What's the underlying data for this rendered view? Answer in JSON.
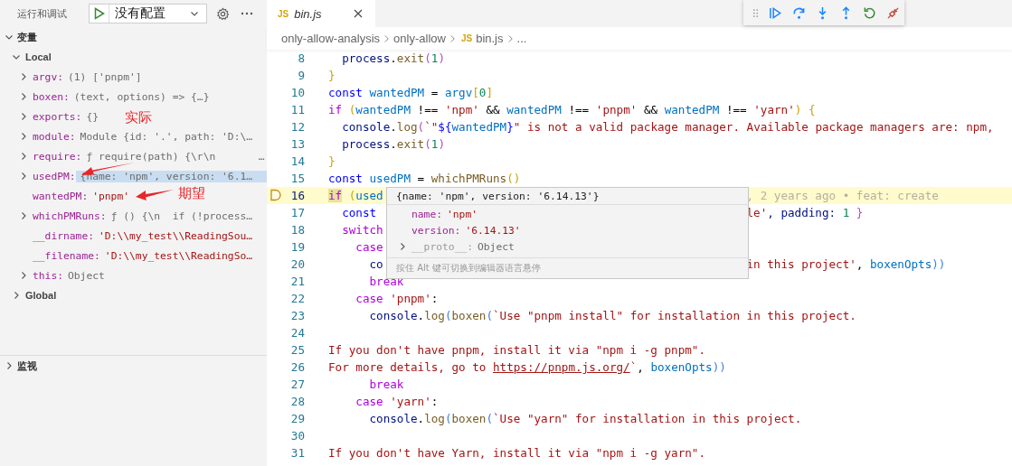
{
  "sidebar": {
    "title": "运行和调试",
    "config": {
      "label": "没有配置"
    },
    "sections": [
      {
        "title": "变量",
        "expanded": true,
        "scopes": [
          {
            "name": "Local",
            "expanded": true,
            "variables": [
              {
                "name": "argv:",
                "value": "(1) ['pnpm']",
                "kind": "object",
                "expandable": true,
                "selected": false
              },
              {
                "name": "boxen:",
                "value": "(text, options) => {…}",
                "kind": "object",
                "expandable": true,
                "selected": false
              },
              {
                "name": "exports:",
                "value": "{}",
                "kind": "object",
                "expandable": true,
                "selected": false
              },
              {
                "name": "module:",
                "value": "Module {id: '.', path: 'D:\\…",
                "kind": "object",
                "expandable": true,
                "selected": false
              },
              {
                "name": "require:",
                "value": "ƒ require(path) {\\r\\n       …",
                "kind": "object",
                "expandable": true,
                "selected": false
              },
              {
                "name": "usedPM:",
                "value": "{name: 'npm', version: '6.1…",
                "kind": "object",
                "expandable": true,
                "selected": true
              },
              {
                "name": "wantedPM:",
                "value": "'pnpm'",
                "kind": "string",
                "expandable": false,
                "selected": false
              },
              {
                "name": "whichPMRuns:",
                "value": "ƒ () {\\n  if (!process…",
                "kind": "object",
                "expandable": true,
                "selected": false
              },
              {
                "name": "__dirname:",
                "value": "'D:\\\\my_test\\\\ReadingSou…",
                "kind": "string",
                "expandable": false,
                "selected": false
              },
              {
                "name": "__filename:",
                "value": "'D:\\\\my_test\\\\ReadingSo…",
                "kind": "string",
                "expandable": false,
                "selected": false
              },
              {
                "name": "this:",
                "value": "Object",
                "kind": "object",
                "expandable": true,
                "selected": false
              }
            ]
          },
          {
            "name": "Global",
            "expanded": false
          }
        ]
      },
      {
        "title": "监视",
        "expanded": false
      }
    ]
  },
  "annotations": [
    {
      "text": "实际"
    },
    {
      "text": "期望"
    }
  ],
  "tab": {
    "icon": "JS",
    "label": "bin.js"
  },
  "breadcrumbs": [
    {
      "text": "only-allow-analysis"
    },
    {
      "text": "only-allow"
    },
    {
      "text": "bin.js",
      "icon": "JS"
    },
    {
      "text": "..."
    }
  ],
  "code": [
    {
      "number": "8",
      "current": false,
      "tokens": [
        {
          "text": "  process",
          "kind": "var"
        },
        {
          "text": ".",
          "kind": "plain"
        },
        {
          "text": "exit",
          "kind": "fn"
        },
        {
          "text": "(",
          "kind": "b2"
        },
        {
          "text": "1",
          "kind": "num"
        },
        {
          "text": ")",
          "kind": "b2"
        }
      ]
    },
    {
      "number": "9",
      "current": false,
      "tokens": [
        {
          "text": "}",
          "kind": "b1"
        }
      ]
    },
    {
      "number": "10",
      "current": false,
      "tokens": [
        {
          "text": "const",
          "kind": "decl"
        },
        {
          "text": " wantedPM",
          "kind": "cvar"
        },
        {
          "text": " = ",
          "kind": "plain"
        },
        {
          "text": "argv",
          "kind": "cvar"
        },
        {
          "text": "[",
          "kind": "b1"
        },
        {
          "text": "0",
          "kind": "num"
        },
        {
          "text": "]",
          "kind": "b1"
        }
      ]
    },
    {
      "number": "11",
      "current": false,
      "tokens": [
        {
          "text": "if",
          "kind": "kw"
        },
        {
          "text": " (",
          "kind": "b1"
        },
        {
          "text": "wantedPM",
          "kind": "cvar"
        },
        {
          "text": " !== ",
          "kind": "plain"
        },
        {
          "text": "'npm'",
          "kind": "str"
        },
        {
          "text": " && ",
          "kind": "plain"
        },
        {
          "text": "wantedPM",
          "kind": "cvar"
        },
        {
          "text": " !== ",
          "kind": "plain"
        },
        {
          "text": "'pnpm'",
          "kind": "str"
        },
        {
          "text": " && ",
          "kind": "plain"
        },
        {
          "text": "wantedPM",
          "kind": "cvar"
        },
        {
          "text": " !== ",
          "kind": "plain"
        },
        {
          "text": "'yarn'",
          "kind": "str"
        },
        {
          "text": ") {",
          "kind": "b1"
        }
      ]
    },
    {
      "number": "12",
      "current": false,
      "tokens": [
        {
          "text": "  console",
          "kind": "var"
        },
        {
          "text": ".",
          "kind": "plain"
        },
        {
          "text": "log",
          "kind": "fn"
        },
        {
          "text": "(",
          "kind": "b2"
        },
        {
          "text": "`\"",
          "kind": "str"
        },
        {
          "text": "${",
          "kind": "decl"
        },
        {
          "text": "wantedPM",
          "kind": "cvar"
        },
        {
          "text": "}",
          "kind": "decl"
        },
        {
          "text": "\" is not a valid package manager. Available package managers are: npm, ",
          "kind": "str"
        }
      ]
    },
    {
      "number": "13",
      "current": false,
      "tokens": [
        {
          "text": "  process",
          "kind": "var"
        },
        {
          "text": ".",
          "kind": "plain"
        },
        {
          "text": "exit",
          "kind": "fn"
        },
        {
          "text": "(",
          "kind": "b2"
        },
        {
          "text": "1",
          "kind": "num"
        },
        {
          "text": ")",
          "kind": "b2"
        }
      ]
    },
    {
      "number": "14",
      "current": false,
      "tokens": [
        {
          "text": "}",
          "kind": "b1"
        }
      ]
    },
    {
      "number": "15",
      "current": false,
      "tokens": [
        {
          "text": "const",
          "kind": "decl"
        },
        {
          "text": " usedPM",
          "kind": "cvar"
        },
        {
          "text": " = ",
          "kind": "plain"
        },
        {
          "text": "whichPMRuns",
          "kind": "fn"
        },
        {
          "text": "()",
          "kind": "b1"
        }
      ]
    },
    {
      "number": "16",
      "current": true,
      "tokens": [
        {
          "text": "if",
          "kind": "kw"
        },
        {
          "text": " (",
          "kind": "b1"
        },
        {
          "text": "used",
          "kind": "cvar"
        }
      ],
      "blame": ", 2 years ago • feat: create"
    },
    {
      "number": "17",
      "current": false,
      "tokens": [
        {
          "text": "  const",
          "kind": "decl"
        }
      ],
      "tail": [
        {
          "text": "le'",
          "kind": "str"
        },
        {
          "text": ", padding: ",
          "kind": "var"
        },
        {
          "text": "1",
          "kind": "num"
        },
        {
          "text": " }",
          "kind": "b2"
        }
      ]
    },
    {
      "number": "18",
      "current": false,
      "tokens": [
        {
          "text": "  switch",
          "kind": "kw"
        }
      ]
    },
    {
      "number": "19",
      "current": false,
      "tokens": [
        {
          "text": "    case",
          "kind": "kw"
        }
      ]
    },
    {
      "number": "20",
      "current": false,
      "tokens": [
        {
          "text": "      co",
          "kind": "var"
        }
      ],
      "tail": [
        {
          "text": "in this project'",
          "kind": "str"
        },
        {
          "text": ", ",
          "kind": "plain"
        },
        {
          "text": "boxenOpts",
          "kind": "cvar"
        },
        {
          "text": "))",
          "kind": "b3"
        }
      ]
    },
    {
      "number": "21",
      "current": false,
      "tokens": [
        {
          "text": "      break",
          "kind": "kw"
        }
      ]
    },
    {
      "number": "22",
      "current": false,
      "tokens": [
        {
          "text": "    case",
          "kind": "kw"
        },
        {
          "text": " 'pnpm'",
          "kind": "str"
        },
        {
          "text": ":",
          "kind": "plain"
        }
      ]
    },
    {
      "number": "23",
      "current": false,
      "tokens": [
        {
          "text": "      console",
          "kind": "var"
        },
        {
          "text": ".",
          "kind": "plain"
        },
        {
          "text": "log",
          "kind": "fn"
        },
        {
          "text": "(",
          "kind": "b3"
        },
        {
          "text": "boxen",
          "kind": "fn"
        },
        {
          "text": "(",
          "kind": "b3"
        },
        {
          "text": "`Use \"pnpm install\" for installation in this project.",
          "kind": "str"
        }
      ]
    },
    {
      "number": "24",
      "current": false
    },
    {
      "number": "25",
      "current": false,
      "tokens": [
        {
          "text": "If you don't have pnpm, install it via \"npm i -g pnpm\".",
          "kind": "str"
        }
      ]
    },
    {
      "number": "26",
      "current": false,
      "tokens": [
        {
          "text": "For more details, go to ",
          "kind": "str"
        },
        {
          "text": "https://pnpm.js.org/",
          "kind": "link"
        },
        {
          "text": "`",
          "kind": "str"
        },
        {
          "text": ", ",
          "kind": "plain"
        },
        {
          "text": "boxenOpts",
          "kind": "cvar"
        },
        {
          "text": "))",
          "kind": "b3"
        }
      ]
    },
    {
      "number": "27",
      "current": false,
      "tokens": [
        {
          "text": "      break",
          "kind": "kw"
        }
      ]
    },
    {
      "number": "28",
      "current": false,
      "tokens": [
        {
          "text": "    case",
          "kind": "kw"
        },
        {
          "text": " 'yarn'",
          "kind": "str"
        },
        {
          "text": ":",
          "kind": "plain"
        }
      ]
    },
    {
      "number": "29",
      "current": false,
      "tokens": [
        {
          "text": "      console",
          "kind": "var"
        },
        {
          "text": ".",
          "kind": "plain"
        },
        {
          "text": "log",
          "kind": "fn"
        },
        {
          "text": "(",
          "kind": "b3"
        },
        {
          "text": "boxen",
          "kind": "fn"
        },
        {
          "text": "(",
          "kind": "b3"
        },
        {
          "text": "`Use \"yarn\" for installation in this project.",
          "kind": "str"
        }
      ]
    },
    {
      "number": "30",
      "current": false
    },
    {
      "number": "31",
      "current": false,
      "tokens": [
        {
          "text": "If you don't have Yarn, install it via \"npm i -g yarn\".",
          "kind": "str"
        }
      ]
    }
  ],
  "hover": {
    "summary": "{name: 'npm', version: '6.14.13'}",
    "rows": [
      {
        "name": "name:",
        "value": "'npm'",
        "kind": "string",
        "expandable": false
      },
      {
        "name": "version:",
        "value": "'6.14.13'",
        "kind": "string",
        "expandable": false
      },
      {
        "name": "__proto__:",
        "value": "Object",
        "kind": "object",
        "expandable": true
      }
    ],
    "footer": "按住 Alt 键可切换到编辑器语言悬停"
  }
}
